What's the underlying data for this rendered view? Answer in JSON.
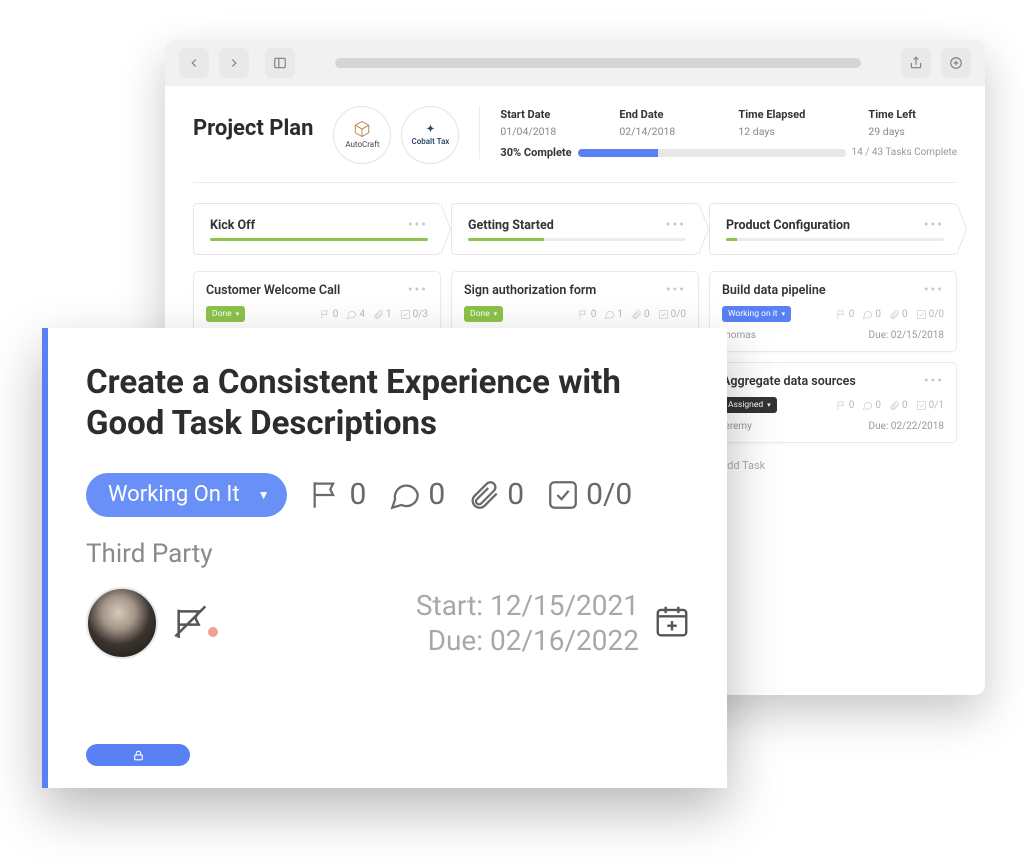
{
  "browser": {
    "page_title": "Project Plan",
    "companies": [
      {
        "name": "AutoCraft"
      },
      {
        "name": "Cobalt Tax"
      }
    ],
    "summary": {
      "start_date": {
        "label": "Start Date",
        "value": "01/04/2018"
      },
      "end_date": {
        "label": "End Date",
        "value": "02/14/2018"
      },
      "time_elapsed": {
        "label": "Time Elapsed",
        "value": "12 days"
      },
      "time_left": {
        "label": "Time Left",
        "value": "29 days"
      },
      "progress_label": "30% Complete",
      "progress_pct": 30,
      "tasks_complete": "14 / 43 Tasks Complete"
    },
    "phases": [
      {
        "name": "Kick Off",
        "progress": 100
      },
      {
        "name": "Getting Started",
        "progress": 35
      },
      {
        "name": "Product Configuration",
        "progress": 5
      }
    ],
    "columns": [
      {
        "cards": [
          {
            "title": "Customer Welcome Call",
            "status_label": "Done",
            "status_class": "status-done",
            "flags": "0",
            "comments": "4",
            "attach": "1",
            "todo": "0/3"
          }
        ]
      },
      {
        "cards": [
          {
            "title": "Sign authorization form",
            "status_label": "Done",
            "status_class": "status-done",
            "flags": "0",
            "comments": "1",
            "attach": "0",
            "todo": "0/0"
          }
        ]
      },
      {
        "cards": [
          {
            "title": "Build data pipeline",
            "status_label": "Working on it",
            "status_class": "status-working",
            "flags": "0",
            "comments": "0",
            "attach": "0",
            "todo": "0/0",
            "assignee": "thomas",
            "due": "Due: 02/15/2018"
          },
          {
            "title": "Aggregate data sources",
            "status_label": "Assigned",
            "status_class": "status-assigned",
            "flags": "0",
            "comments": "0",
            "attach": "0",
            "todo": "0/1",
            "assignee": "jeremy",
            "due": "Due: 02/22/2018"
          }
        ],
        "add_task": "+ Add Task"
      }
    ]
  },
  "task": {
    "title": "Create a Consistent Experience with Good Task Descriptions",
    "status": "Working On It",
    "flags": "0",
    "comments": "0",
    "attachments": "0",
    "todo": "0/0",
    "category": "Third Party",
    "start_label": "Start:",
    "start_date": "12/15/2021",
    "due_label": "Due:",
    "due_date": "02/16/2022"
  }
}
